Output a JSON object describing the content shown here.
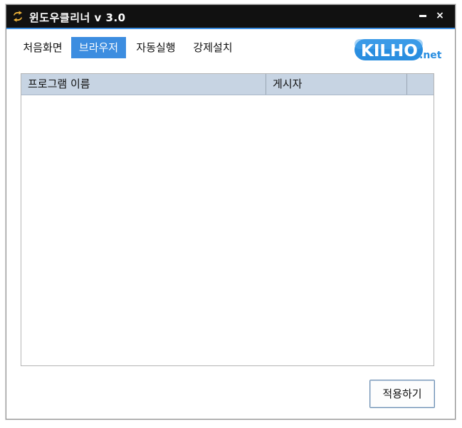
{
  "window": {
    "title": "윈도우클리너 v 3.0",
    "minimize_label": "–",
    "close_label": "×"
  },
  "tabs": [
    {
      "label": "처음화면",
      "active": false
    },
    {
      "label": "브라우저",
      "active": true
    },
    {
      "label": "자동실행",
      "active": false
    },
    {
      "label": "강제설치",
      "active": false
    }
  ],
  "logo": {
    "main": "KILHO",
    "suffix": ".net"
  },
  "list": {
    "columns": [
      "프로그램 이름",
      "게시자",
      ""
    ],
    "rows": []
  },
  "apply_label": "적용하기",
  "colors": {
    "accent": "#3c8de0",
    "titlebar": "#111111",
    "header": "#c7d4e3"
  },
  "icons": {
    "app": "refresh-arrows-icon",
    "logo": "kilho-logo"
  }
}
